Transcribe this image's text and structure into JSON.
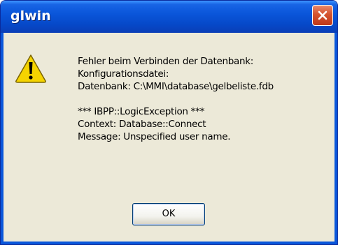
{
  "window": {
    "title": "glwin"
  },
  "icons": {
    "warning": "warning-icon",
    "close": "close-icon"
  },
  "message": {
    "lines_group1": [
      "Fehler beim Verbinden der Datenbank:",
      "Konfigurationsdatei:",
      "Datenbank: C:\\MMI\\database\\gelbeliste.fdb"
    ],
    "lines_group2": [
      "*** IBPP::LogicException ***",
      "Context: Database::Connect",
      "Message: Unspecified user name."
    ]
  },
  "buttons": {
    "ok_label": "OK"
  },
  "colors": {
    "titlebar": "#0a56da",
    "dialog_bg": "#ece9d8",
    "close_button": "#d4532f",
    "warning_yellow": "#f5d400"
  }
}
